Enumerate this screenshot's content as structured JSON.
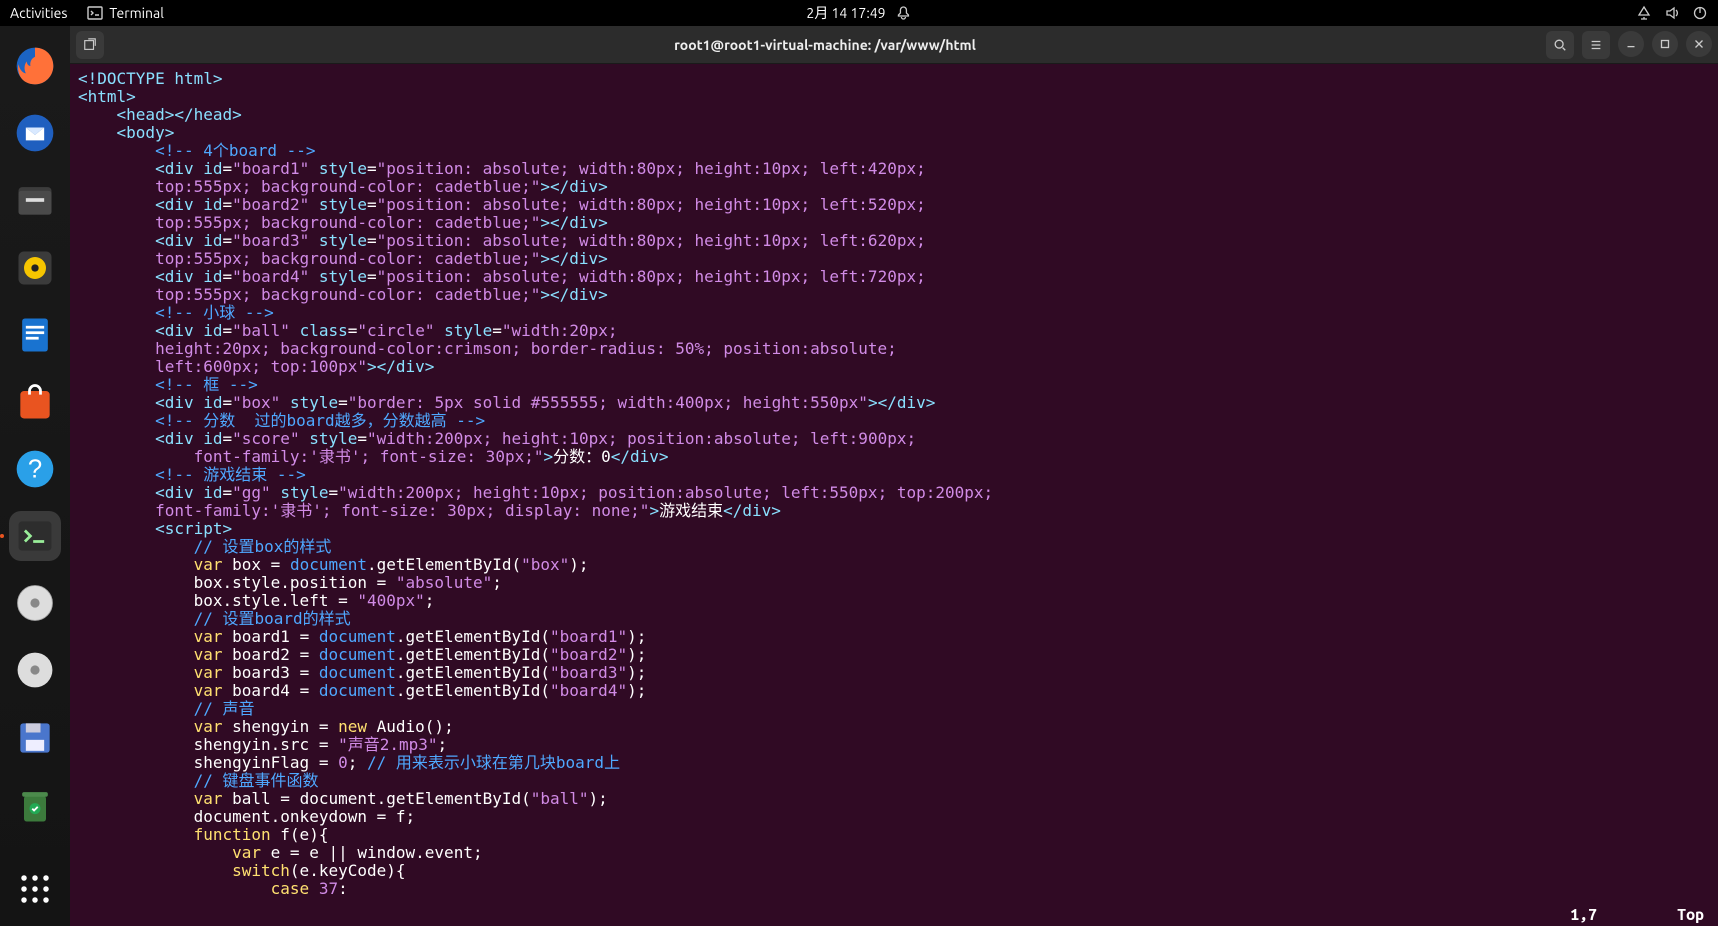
{
  "top_panel": {
    "activities": "Activities",
    "app_label": "Terminal",
    "datetime": "2月 14  17:49"
  },
  "titlebar": {
    "title": "root1@root1-virtual-machine: /var/www/html"
  },
  "statusbar": {
    "pos": "1,7",
    "mode": "Top"
  },
  "code": {
    "l1_doctype": "<!DOCTYPE html>",
    "l2": "<html>",
    "l3": "    <head></head>",
    "l4": "    <body>",
    "c_boards": "        <!-- 4个board -->",
    "b1a": "        <div id=\"board1\" style=\"position: absolute; width:80px; height:10px; left:420px;",
    "b1b": "        top:555px; background-color: cadetblue;\"></div>",
    "b2a": "        <div id=\"board2\" style=\"position: absolute; width:80px; height:10px; left:520px;",
    "b2b": "        top:555px; background-color: cadetblue;\"></div>",
    "b3a": "        <div id=\"board3\" style=\"position: absolute; width:80px; height:10px; left:620px;",
    "b3b": "        top:555px; background-color: cadetblue;\"></div>",
    "b4a": "        <div id=\"board4\" style=\"position: absolute; width:80px; height:10px; left:720px;",
    "b4b": "        top:555px; background-color: cadetblue;\"></div>",
    "c_ball": "        <!-- 小球 -->",
    "ball_a": "        <div id=\"ball\" class=\"circle\" style=\"width:20px;",
    "ball_b": "        height:20px; background-color:crimson; border-radius: 50%; position:absolute;",
    "ball_c": "        left:600px; top:100px\"></div>",
    "c_box": "        <!-- 框 -->",
    "box_l": "        <div id=\"box\" style=\"border: 5px solid #555555; width:400px; height:550px\"></div>",
    "c_score": "        <!-- 分数  过的board越多，分数越高 -->",
    "score_a": "        <div id=\"score\" style=\"width:200px; height:10px; position:absolute; left:900px;",
    "score_b_pre": "            font-family:'隶书'; font-size: 30px;\">",
    "score_text": "分数：0",
    "score_close": "</div>",
    "c_gg": "        <!-- 游戏结束 -->",
    "gg_a": "        <div id=\"gg\" style=\"width:200px; height:10px; position:absolute; left:550px; top:200px;",
    "gg_b_pre": "        font-family:'隶书'; font-size: 30px; display: none;\">",
    "gg_text": "游戏结束",
    "gg_close": "</div>",
    "script_open": "        <script>",
    "js1": "            // 设置box的样式",
    "js2": "            var box = document.getElementById(\"box\");",
    "js3": "            box.style.position = \"absolute\";",
    "js4": "            box.style.left = \"400px\";",
    "js5": "            // 设置board的样式",
    "js6": "            var board1 = document.getElementById(\"board1\");",
    "js7": "            var board2 = document.getElementById(\"board2\");",
    "js8": "            var board3 = document.getElementById(\"board3\");",
    "js9": "            var board4 = document.getElementById(\"board4\");",
    "js10": "            // 声音",
    "js11": "            var shengyin = new Audio();",
    "js12": "            shengyin.src = \"声音2.mp3\";",
    "js13": "            shengyinFlag = 0; // 用来表示小球在第几块board上",
    "js14": "            // 键盘事件函数",
    "js15": "            var ball = document.getElementById(\"ball\");",
    "js16": "            document.onkeydown = f;",
    "js17": "            function f(e){",
    "js18": "                var e = e || window.event;",
    "js19": "                switch(e.keyCode){",
    "js20": "                    case 37:"
  }
}
